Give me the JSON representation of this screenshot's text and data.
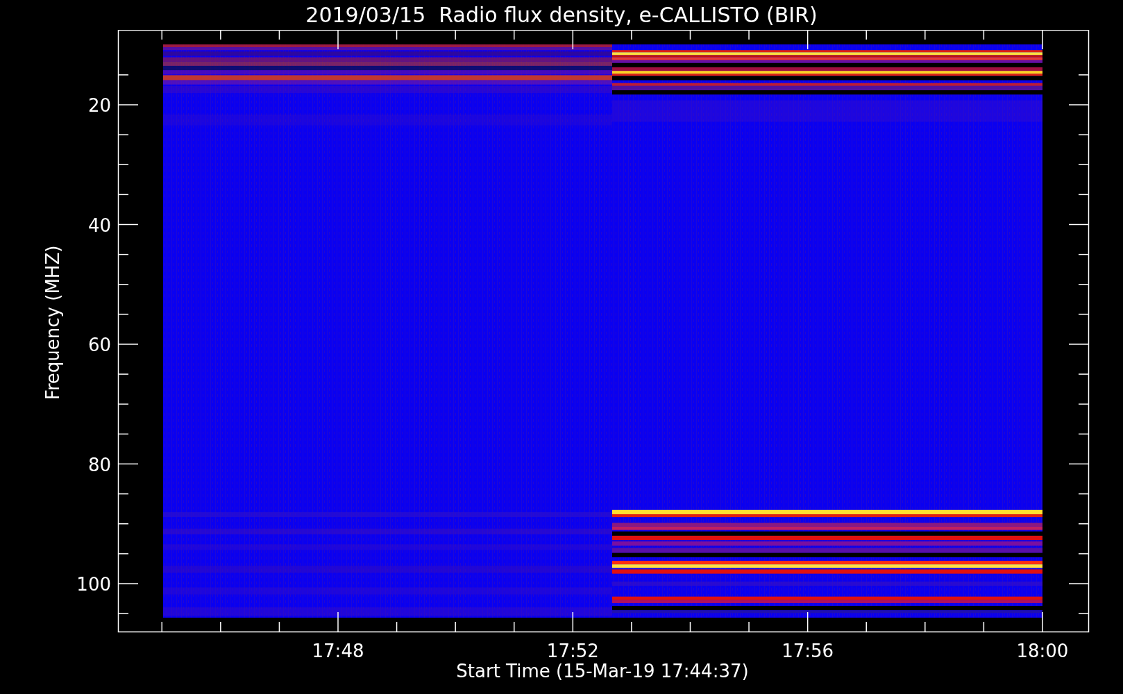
{
  "title": "2019/03/15  Radio flux density, e-CALLISTO (BIR)",
  "y_axis": {
    "label": "Frequency (MHZ)",
    "ticks": [
      "20",
      "40",
      "60",
      "80",
      "100"
    ]
  },
  "x_axis": {
    "label": "Start Time (15-Mar-19 17:44:37)",
    "ticks": [
      "17:48",
      "17:52",
      "17:56",
      "18:00"
    ]
  }
}
